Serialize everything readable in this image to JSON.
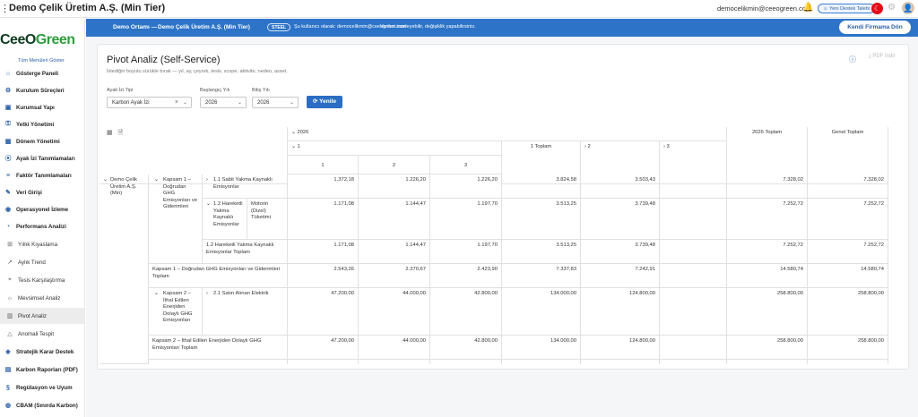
{
  "titlebar": {
    "title": "Demo Çelik Üretim A.Ş. (Min Tier)",
    "email": "democelikmin@ceeogreen.com",
    "support_label": "Yeni Destek Talebi"
  },
  "sidebar": {
    "logo_a": "CeeO",
    "logo_b": "Green",
    "show_all": "Tüm Menüleri Göster",
    "items": [
      {
        "label": "Gösterge Paneli",
        "icon": "home-icon"
      },
      {
        "label": "Kurulum Süreçleri",
        "icon": "setup-icon"
      },
      {
        "label": "Kurumsal Yapı",
        "icon": "building-icon"
      },
      {
        "label": "Yetki Yönetimi",
        "icon": "key-icon"
      },
      {
        "label": "Dönem Yönetimi",
        "icon": "calendar-icon"
      },
      {
        "label": "Ayak İzi Tanımlamaları",
        "icon": "footprint-icon"
      },
      {
        "label": "Faktör Tanımlamaları",
        "icon": "factor-icon"
      },
      {
        "label": "Veri Girişi",
        "icon": "edit-icon"
      },
      {
        "label": "Operasyonel İzleme",
        "icon": "monitor-icon"
      },
      {
        "label": "Performans Analizi",
        "icon": "analysis-icon"
      },
      {
        "label": "Yıllık Kıyaslama",
        "icon": "compare-icon"
      },
      {
        "label": "Aylık Trend",
        "icon": "trend-icon"
      },
      {
        "label": "Tesis Karşılaştırma",
        "icon": "facility-icon"
      },
      {
        "label": "Mevsimsel Analiz",
        "icon": "season-icon"
      },
      {
        "label": "Pivot Analiz",
        "icon": "pivot-icon"
      },
      {
        "label": "Anomali Tespit",
        "icon": "warning-icon"
      },
      {
        "label": "Stratejik Karar Destek",
        "icon": "strategy-icon"
      },
      {
        "label": "Karbon Raporları (PDF)",
        "icon": "report-icon"
      },
      {
        "label": "Regülasyon ve Uyum",
        "icon": "regulation-icon"
      },
      {
        "label": "CBAM (Sınırda Karbon)",
        "icon": "cbam-icon"
      }
    ]
  },
  "banner": {
    "env": "Demo Ortamı —",
    "company": "Demo Çelik Üretim A.Ş. (Min Tier)",
    "tier_badge": "STEEL",
    "login_as": "Şu kullanıcı olarak: democelikmin@ceeogreen.com",
    "notice": "Verileri inceleyebilir, değişiklik yapabilirsiniz.",
    "return_button": "Kendi Firmama Dön"
  },
  "page": {
    "title": "Pivot Analiz (Self-Service)",
    "subtitle": "İstediğin boyutu sürükle bırak — yıl, ay, çeyrek, tesis, scope, aktivite, neden, asset.",
    "pdf_button": "PDF İndir"
  },
  "filters": {
    "footprint_label": "Ayak İzi Tipi",
    "footprint_value": "Karbon Ayak İzi",
    "start_label": "Başlangıç Yılı",
    "start_value": "2026",
    "end_label": "Bitiş Yılı",
    "end_value": "2026",
    "refresh_button": "Yenile"
  },
  "pivot": {
    "year": "2026",
    "q1": "1",
    "q1_total": "1 Toplam",
    "q2": "2",
    "q3": "3",
    "year_total": "2026 Toplam",
    "grand_total": "Genel Toplam",
    "months": [
      "1",
      "2",
      "3"
    ],
    "company": "Demo Çelik Üretim A.Ş. (Min)",
    "scope1": "Kapsam 1 – Doğrudan GHG Emisyonları ve Giderimleri",
    "src_1_1": "1.1 Sabit Yakma Kaynaklı Emisyonlar",
    "src_1_2": "1.2 Hareketli Yakma Kaynaklı Emisyonlar",
    "fuel_diesel": "Motorin (Dizel) Tüketimi",
    "src_1_2_total": "1.2 Hareketli Yakma Kaynaklı Emisyonlar Toplam",
    "scope1_total": "Kapsam 1 – Doğrudan GHG Emisyonları ve Giderimleri Toplam",
    "scope2": "Kapsam 2 – İthal Edilen Enerjiden Dolaylı GHG Emisyonları",
    "src_2_1": "2.1 Satın Alınan Elektrik",
    "scope2_total": "Kapsam 2 – İthal Edilen Enerjiden Dolaylı GHG Emisyonları Toplam",
    "rows": [
      {
        "m1": "1.372,18",
        "m2": "1.226,20",
        "m3": "1.226,20",
        "q1t": "3.824,58",
        "q2": "3.503,43",
        "yt": "7.328,02",
        "gt": "7.328,02"
      },
      {
        "m1": "1.171,08",
        "m2": "1.144,47",
        "m3": "1.197,70",
        "q1t": "3.513,25",
        "q2": "3.739,48",
        "yt": "7.252,72",
        "gt": "7.252,72"
      },
      {
        "m1": "1.171,08",
        "m2": "1.144,47",
        "m3": "1.197,70",
        "q1t": "3.513,25",
        "q2": "3.739,48",
        "yt": "7.252,72",
        "gt": "7.252,72"
      },
      {
        "m1": "2.543,26",
        "m2": "2.370,67",
        "m3": "2.423,90",
        "q1t": "7.337,83",
        "q2": "7.242,91",
        "yt": "14.580,74",
        "gt": "14.580,74"
      },
      {
        "m1": "47.200,00",
        "m2": "44.000,00",
        "m3": "42.800,00",
        "q1t": "134.000,00",
        "q2": "124.800,00",
        "yt": "258.800,00",
        "gt": "258.800,00"
      },
      {
        "m1": "47.200,00",
        "m2": "44.000,00",
        "m3": "42.800,00",
        "q1t": "134.000,00",
        "q2": "124.800,00",
        "yt": "258.800,00",
        "gt": "258.800,00"
      }
    ]
  }
}
